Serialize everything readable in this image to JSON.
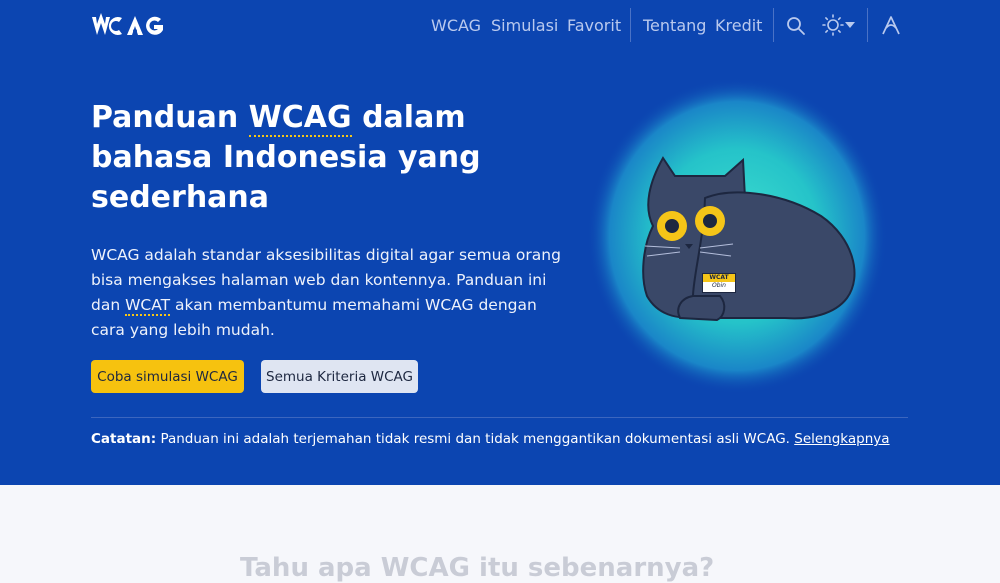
{
  "nav": {
    "logo_text": "WCAG",
    "links": [
      "WCAG",
      "Simulasi",
      "Favorit",
      "Tentang",
      "Kredit"
    ]
  },
  "hero": {
    "title_pre": "Panduan ",
    "title_abbr": "WCAG",
    "title_post": " dalam bahasa Indonesia yang sederhana",
    "lede_pre": "WCAG adalah standar aksesibilitas digital agar semua orang bisa mengakses halaman web dan kontennya. Panduan ini dan ",
    "lede_abbr": "WCAT",
    "lede_post": " akan membantumu memahami WCAG dengan cara yang lebih mudah.",
    "primary_button": "Coba simulasi WCAG",
    "secondary_button": "Semua Kriteria WCAG",
    "note_label": "Catatan:",
    "note_text": " Panduan ini adalah terjemahan tidak resmi dan tidak menggantikan dokumentasi asli WCAG. ",
    "note_link": "Selengkapnya"
  },
  "cat_badge": {
    "line1": "WCAT",
    "line2": "Obin"
  },
  "lower": {
    "heading": "Tahu apa WCAG itu sebenarnya?"
  },
  "colors": {
    "hero_bg": "#0c45b1",
    "accent": "#f6c20f"
  }
}
